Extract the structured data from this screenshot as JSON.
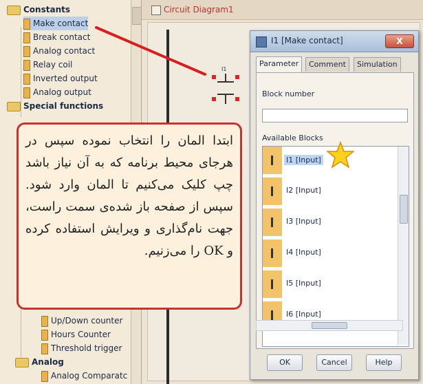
{
  "tree": {
    "items_top": [
      {
        "label": "Constants",
        "kind": "folder",
        "bold": true
      },
      {
        "label": "Make contact",
        "kind": "leaf",
        "selected": true
      },
      {
        "label": "Break contact",
        "kind": "leaf"
      },
      {
        "label": "Analog contact",
        "kind": "leaf"
      },
      {
        "label": "Relay coil",
        "kind": "leaf"
      },
      {
        "label": "Inverted output",
        "kind": "leaf"
      },
      {
        "label": "Analog output",
        "kind": "leaf"
      },
      {
        "label": "Special functions",
        "kind": "folder",
        "bold": true
      }
    ],
    "items_bottom": [
      {
        "label": "Up/Down counter",
        "kind": "leaf"
      },
      {
        "label": "Hours Counter",
        "kind": "leaf"
      },
      {
        "label": "Threshold trigger",
        "kind": "leaf"
      },
      {
        "label": "Analog",
        "kind": "folder",
        "bold": true
      },
      {
        "label": "Analog Comparatc",
        "kind": "leaf"
      }
    ]
  },
  "diagram": {
    "tab_label": "Circuit Diagram1"
  },
  "dialog": {
    "title": "I1 [Make contact]",
    "close_label": "X",
    "tabs": [
      "Parameter",
      "Comment",
      "Simulation"
    ],
    "block_number_label": "Block number",
    "block_number_value": "",
    "available_blocks_label": "Available Blocks",
    "blocks": [
      "I1 [Input]",
      "I2 [Input]",
      "I3 [Input]",
      "I4 [Input]",
      "I5 [Input]",
      "I6 [Input]"
    ],
    "scroll_arrow": "‹",
    "scroll_marks": "III",
    "buttons": {
      "ok": "OK",
      "cancel": "Cancel",
      "help": "Help"
    }
  },
  "annotation": {
    "text": "ابتدا المان را انتخاب نموده سپس در هرجای محیط برنامه که به آن نیاز باشد چپ کلیک می‌کنیم تا المان وارد شود. سپس از صفحه باز شده‌ی سمت راست، جهت نام‌گذاری و ویرایش استفاده کرده و OK را می‌زنیم.",
    "border_color": "#c7312f",
    "arrow_color": "#d62020",
    "star_color": "#ffd21f"
  },
  "block_symbol": {
    "label": "I1"
  }
}
